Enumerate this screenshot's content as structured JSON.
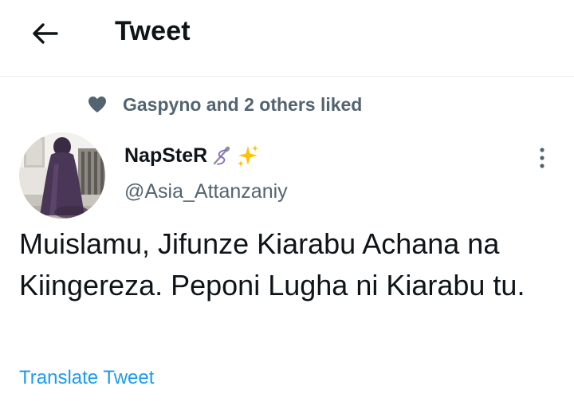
{
  "header": {
    "back_icon": "arrow-left-icon",
    "title": "Tweet"
  },
  "social_context": {
    "icon": "heart-icon",
    "text": "Gaspyno and 2 others liked"
  },
  "tweet": {
    "author": {
      "display_name": "NapSteR",
      "display_name_emojis": [
        "needle-thread-icon",
        "sparkles-icon"
      ],
      "handle": "@Asia_Attanzaniy"
    },
    "more_icon": "more-vertical-icon",
    "text": "Muislamu, Jifunze Kiarabu Achana na Kiingereza. Peponi Lugha ni Kiarabu tu.",
    "translate_label": "Translate Tweet"
  },
  "colors": {
    "secondary_text": "#536471",
    "link": "#1d9bf0",
    "primary_text": "#0f1419",
    "divider": "#e6e9ec"
  }
}
